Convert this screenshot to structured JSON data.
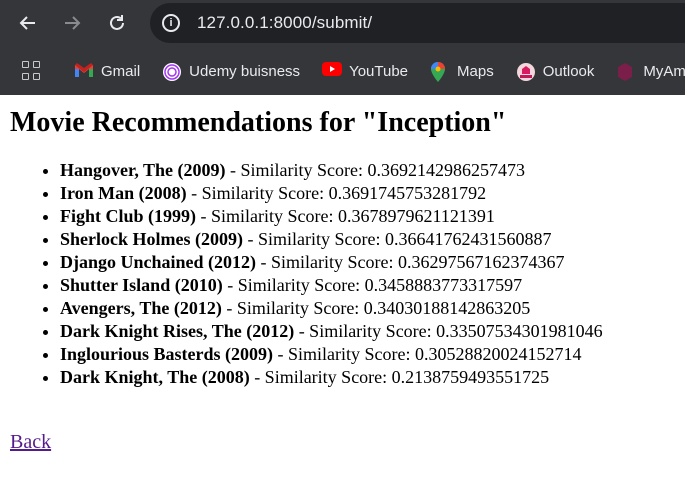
{
  "browser": {
    "url": "127.0.0.1:8000/submit/",
    "bookmarks": [
      {
        "label": "Gmail",
        "icon": "gmail-icon"
      },
      {
        "label": "Udemy buisness",
        "icon": "udemy-icon"
      },
      {
        "label": "YouTube",
        "icon": "youtube-icon"
      },
      {
        "label": "Maps",
        "icon": "maps-icon"
      },
      {
        "label": "Outlook",
        "icon": "outlook-icon"
      },
      {
        "label": "MyAm",
        "icon": "myam-icon"
      }
    ]
  },
  "page": {
    "title": "Movie Recommendations for \"Inception\"",
    "recommendations": [
      {
        "movie": "Hangover, The (2009)",
        "score_text": " - Similarity Score: 0.3692142986257473"
      },
      {
        "movie": "Iron Man (2008)",
        "score_text": " - Similarity Score: 0.3691745753281792"
      },
      {
        "movie": "Fight Club (1999)",
        "score_text": " - Similarity Score: 0.3678979621121391"
      },
      {
        "movie": "Sherlock Holmes (2009)",
        "score_text": " - Similarity Score: 0.36641762431560887"
      },
      {
        "movie": "Django Unchained (2012)",
        "score_text": " - Similarity Score: 0.36297567162374367"
      },
      {
        "movie": "Shutter Island (2010)",
        "score_text": " - Similarity Score: 0.3458883773317597"
      },
      {
        "movie": "Avengers, The (2012)",
        "score_text": " - Similarity Score: 0.34030188142863205"
      },
      {
        "movie": "Dark Knight Rises, The (2012)",
        "score_text": " - Similarity Score: 0.33507534301981046"
      },
      {
        "movie": "Inglourious Basterds (2009)",
        "score_text": " - Similarity Score: 0.30528820024152714"
      },
      {
        "movie": "Dark Knight, The (2008)",
        "score_text": " - Similarity Score: 0.2138759493551725"
      }
    ],
    "back_label": "Back",
    "link_color": "#551a8b"
  }
}
